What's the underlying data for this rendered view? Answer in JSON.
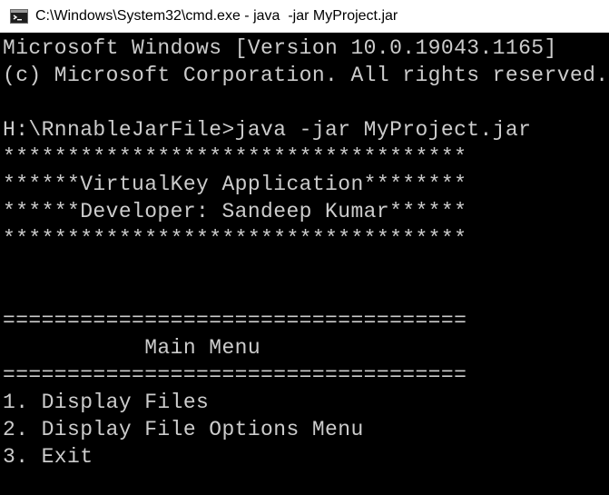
{
  "window": {
    "title": "C:\\Windows\\System32\\cmd.exe - java  -jar MyProject.jar",
    "icon": "cmd-console-icon"
  },
  "console": {
    "lines": [
      "Microsoft Windows [Version 10.0.19043.1165]",
      "(c) Microsoft Corporation. All rights reserved.",
      "",
      "H:\\RnnableJarFile>java -jar MyProject.jar",
      "************************************",
      "******VirtualKey Application********",
      "******Developer: Sandeep Kumar******",
      "************************************",
      "",
      "",
      "====================================",
      "           Main Menu",
      "====================================",
      "1. Display Files",
      "2. Display File Options Menu",
      "3. Exit",
      ""
    ]
  },
  "colors": {
    "console_background": "#000000",
    "console_text": "#cccccc",
    "titlebar_background": "#ffffff"
  }
}
